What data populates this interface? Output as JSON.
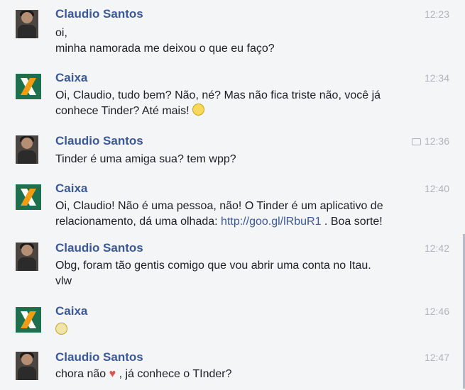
{
  "messages": [
    {
      "sender": "Claudio Santos",
      "time": "12:23",
      "lines": [
        "oi,",
        "minha namorada me deixou o que eu faço?"
      ],
      "avatar": "claudio-avatar"
    },
    {
      "sender": "Caixa",
      "time": "12:34",
      "lines": [
        "Oi, Claudio, tudo bem? Não, né? Mas não fica triste não, você já",
        "conhece Tinder? Até mais!"
      ],
      "avatar": "caixa-logo"
    },
    {
      "sender": "Claudio Santos",
      "time": "12:36",
      "lines": [
        "Tinder é uma amiga sua? tem wpp?"
      ],
      "avatar": "claudio-avatar"
    },
    {
      "sender": "Caixa",
      "time": "12:40",
      "lines": [
        "Oi, Claudio! Não é uma pessoa, não! O Tinder é um aplicativo de",
        "relacionamento, dá uma olhada:"
      ],
      "link": "http://goo.gl/lRbuR1",
      "after_link": ". Boa sorte!",
      "avatar": "caixa-logo"
    },
    {
      "sender": "Claudio Santos",
      "time": "12:42",
      "lines": [
        "Obg, foram tão gentis comigo que vou abrir uma conta no Itau.",
        "vlw"
      ],
      "avatar": "claudio-avatar"
    },
    {
      "sender": "Caixa",
      "time": "12:46",
      "lines": [],
      "avatar": "caixa-logo"
    },
    {
      "sender": "Claudio Santos",
      "time": "12:47",
      "lines": [
        "chora não",
        ", já conhece o TInder?"
      ],
      "avatar": "claudio-avatar"
    }
  ],
  "icons": {
    "seen": "seen-icon",
    "smile": "smile-emoji",
    "sad": "sad-emoji",
    "heart": "heart-emoji"
  },
  "colors": {
    "sender": "#3b5998",
    "caixa_green": "#1d6f4d",
    "caixa_orange": "#f39c12"
  }
}
